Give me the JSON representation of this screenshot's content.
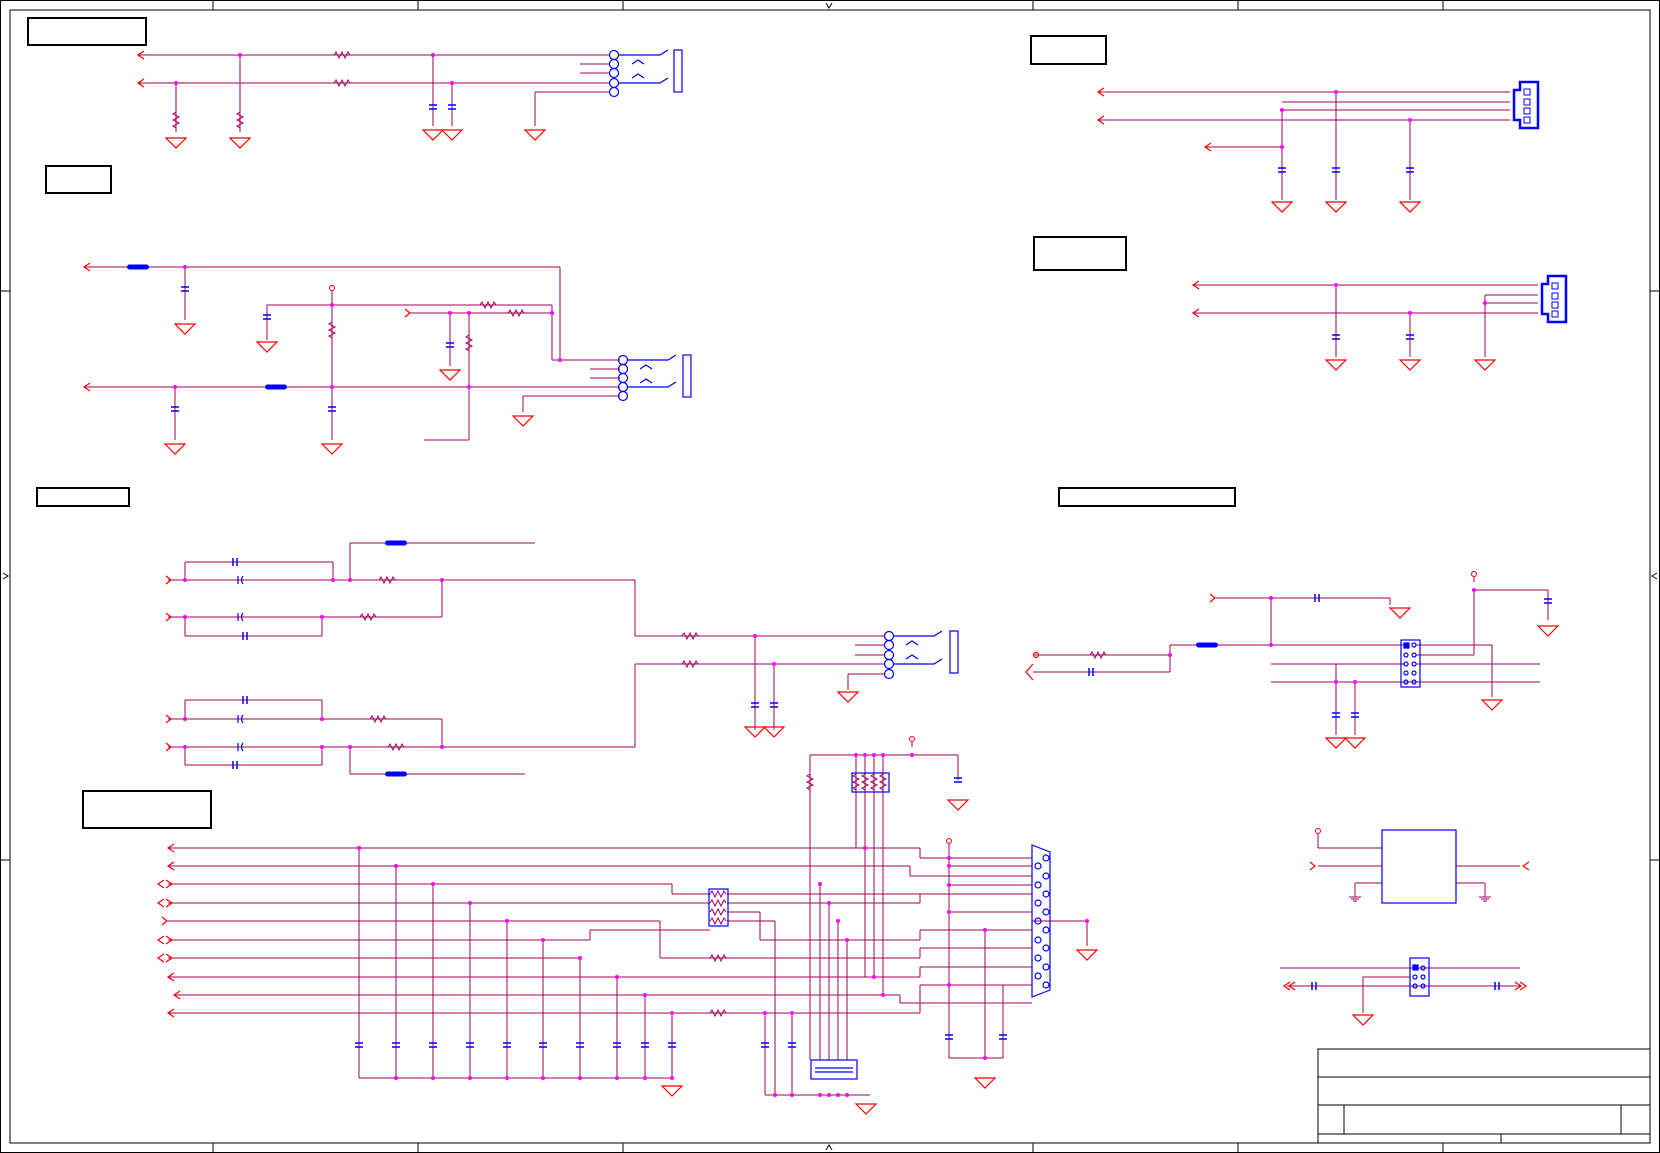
{
  "sheet": {
    "title_blocks": [
      "",
      "",
      "",
      "",
      "",
      ""
    ],
    "title_box_rows": [
      "",
      "",
      ""
    ]
  },
  "colors": {
    "wire": "#a0005a",
    "symbol": "#ff0000",
    "part": "#0000ff",
    "junction": "#ff00ff",
    "frame": "#000000"
  },
  "icons": [
    "ground-symbol",
    "power-flag",
    "capacitor",
    "resistor",
    "connector-jack",
    "ferrite-bead",
    "db15-connector",
    "header",
    "ic-chip",
    "off-page-arrow"
  ]
}
